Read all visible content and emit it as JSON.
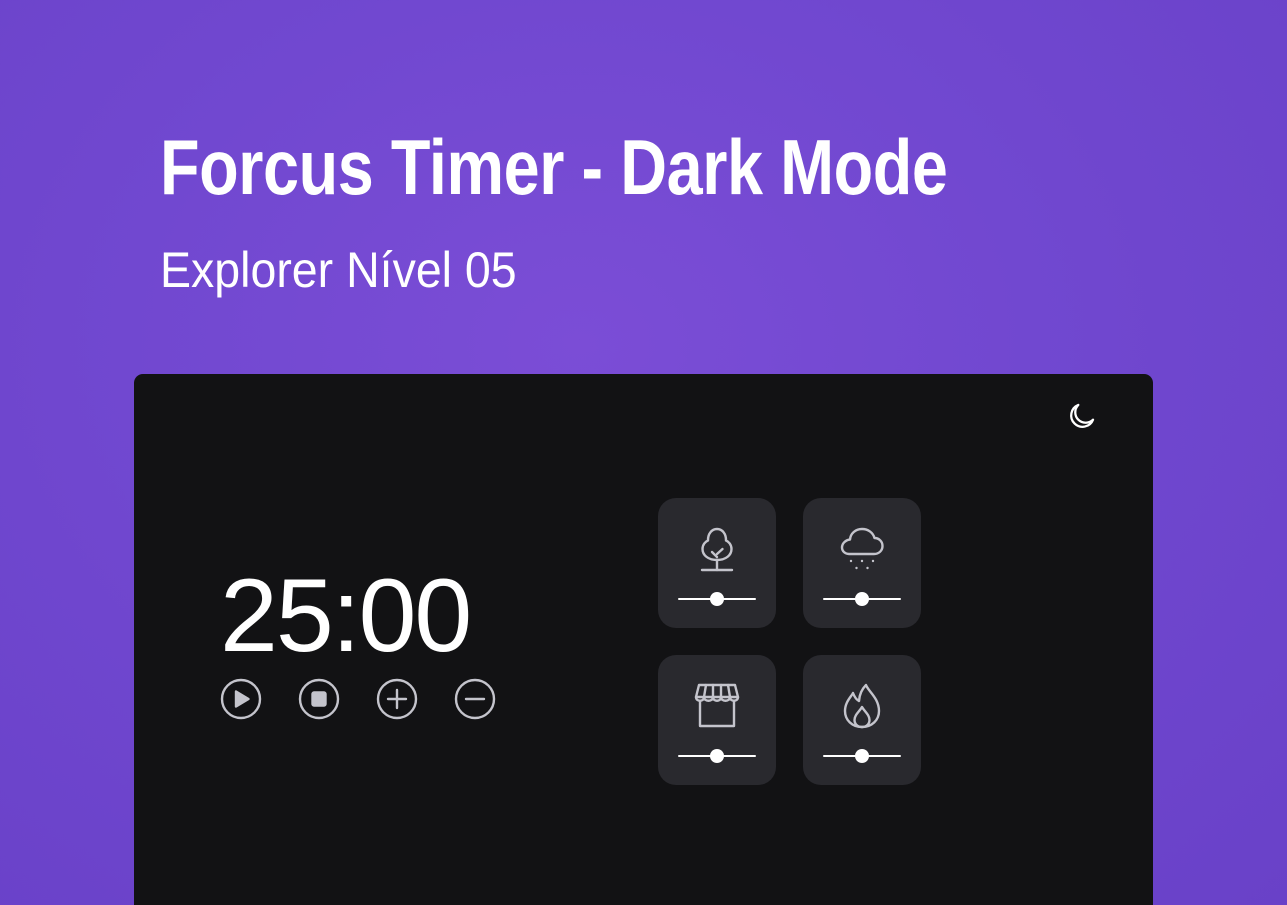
{
  "header": {
    "title": "Forcus Timer - Dark Mode",
    "subtitle": "Explorer Nível 05"
  },
  "colors": {
    "background": "#7148d0",
    "panel": "#121214",
    "card": "#29292e",
    "text": "#ffffff",
    "icon": "#c4c4cc"
  },
  "app": {
    "theme_toggle_icon": "moon-icon",
    "timer": {
      "minutes": "25",
      "separator": ":",
      "seconds": "00"
    },
    "controls": [
      {
        "name": "play-button",
        "icon": "play-icon"
      },
      {
        "name": "stop-button",
        "icon": "stop-icon"
      },
      {
        "name": "increase-button",
        "icon": "plus-icon"
      },
      {
        "name": "decrease-button",
        "icon": "minus-icon"
      }
    ],
    "sounds": [
      {
        "name": "forest",
        "icon": "tree-icon",
        "volume": 0.5
      },
      {
        "name": "rain",
        "icon": "cloud-rain-icon",
        "volume": 0.5
      },
      {
        "name": "coffee-shop",
        "icon": "storefront-icon",
        "volume": 0.5
      },
      {
        "name": "fireplace",
        "icon": "fire-icon",
        "volume": 0.5
      }
    ]
  }
}
